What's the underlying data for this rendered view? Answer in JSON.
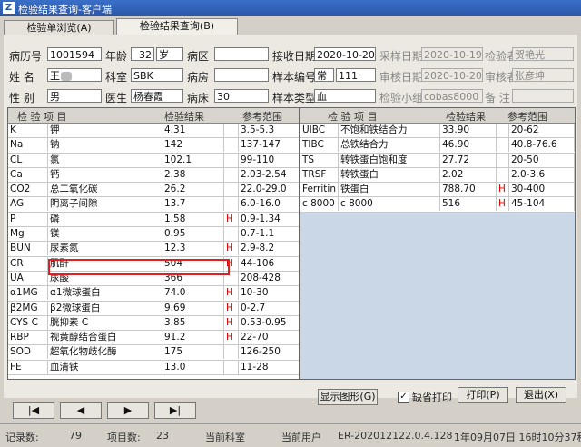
{
  "window": {
    "title": "检验结果查询-客户端"
  },
  "tabs": [
    {
      "label": "检验单浏览(A)"
    },
    {
      "label": "检验结果查询(B)"
    }
  ],
  "form": {
    "patient_id_label": "病历号",
    "patient_id": "1001594",
    "age_label": "年龄",
    "age": "32",
    "age_unit": "岁",
    "ward_label": "病区",
    "ward": "",
    "receive_date_label": "接收日期",
    "receive_date": "2020-10-20",
    "collect_date_label": "采样日期",
    "collect_date": "2020-10-19",
    "tester_label": "检验者",
    "tester": "贺艳光",
    "name_label": "姓  名",
    "name": "王",
    "dept_label": "科室",
    "dept": "SBK",
    "room_label": "病房",
    "room": "",
    "sample_no_label": "样本编号",
    "sample_no_prefix": "常",
    "sample_no": "111",
    "review_date_label": "审核日期",
    "review_date": "2020-10-20",
    "reviewer_label": "审核者",
    "reviewer": "张彦坤",
    "gender_label": "性  别",
    "gender": "男",
    "doctor_label": "医生",
    "doctor": "杨春霞",
    "bed_label": "病床",
    "bed": "30",
    "sample_type_label": "样本类型",
    "sample_type": "血",
    "group_label": "检验小组",
    "group": "cobas8000",
    "remark_label": "备  注",
    "remark": ""
  },
  "left_table": {
    "headers": [
      "检  验  项  目",
      "检验结果",
      "参考范围"
    ],
    "rows": [
      {
        "code": "K",
        "name": "钾",
        "result": "4.31",
        "flag": "",
        "range": "3.5-5.3"
      },
      {
        "code": "Na",
        "name": "钠",
        "result": "142",
        "flag": "",
        "range": "137-147"
      },
      {
        "code": "CL",
        "name": "氯",
        "result": "102.1",
        "flag": "",
        "range": "99-110"
      },
      {
        "code": "Ca",
        "name": "钙",
        "result": "2.38",
        "flag": "",
        "range": "2.03-2.54"
      },
      {
        "code": "CO2",
        "name": "总二氧化碳",
        "result": "26.2",
        "flag": "",
        "range": "22.0-29.0"
      },
      {
        "code": "AG",
        "name": "阴离子间隙",
        "result": "13.7",
        "flag": "",
        "range": "6.0-16.0"
      },
      {
        "code": "P",
        "name": "磷",
        "result": "1.58",
        "flag": "H",
        "range": "0.9-1.34"
      },
      {
        "code": "Mg",
        "name": "镁",
        "result": "0.95",
        "flag": "",
        "range": "0.7-1.1"
      },
      {
        "code": "BUN",
        "name": "尿素氮",
        "result": "12.3",
        "flag": "H",
        "range": "2.9-8.2"
      },
      {
        "code": "CR",
        "name": "肌酐",
        "result": "504",
        "flag": "H",
        "range": "44-106"
      },
      {
        "code": "UA",
        "name": "尿酸",
        "result": "366",
        "flag": "",
        "range": "208-428"
      },
      {
        "code": "α1MG",
        "name": "α1微球蛋白",
        "result": "74.0",
        "flag": "H",
        "range": "10-30"
      },
      {
        "code": "β2MG",
        "name": "β2微球蛋白",
        "result": "9.69",
        "flag": "H",
        "range": "0-2.7"
      },
      {
        "code": "CYS C",
        "name": "胱抑素 C",
        "result": "3.85",
        "flag": "H",
        "range": "0.53-0.95"
      },
      {
        "code": "RBP",
        "name": "视黄醇结合蛋白",
        "result": "91.2",
        "flag": "H",
        "range": "22-70"
      },
      {
        "code": "SOD",
        "name": "超氧化物歧化酶",
        "result": "175",
        "flag": "",
        "range": "126-250"
      },
      {
        "code": "FE",
        "name": "血清铁",
        "result": "13.0",
        "flag": "",
        "range": "11-28"
      }
    ]
  },
  "right_table": {
    "headers": [
      "检  验  项  目",
      "检验结果",
      "参考范围"
    ],
    "rows": [
      {
        "code": "UIBC",
        "name": "不饱和铁结合力",
        "result": "33.90",
        "flag": "",
        "range": "20-62"
      },
      {
        "code": "TIBC",
        "name": "总铁结合力",
        "result": "46.90",
        "flag": "",
        "range": "40.8-76.6"
      },
      {
        "code": "TS",
        "name": "转铁蛋白饱和度",
        "result": "27.72",
        "flag": "",
        "range": "20-50"
      },
      {
        "code": "TRSF",
        "name": "转铁蛋白",
        "result": "2.02",
        "flag": "",
        "range": "2.0-3.6"
      },
      {
        "code": "Ferritin",
        "name": "铁蛋白",
        "result": "788.70",
        "flag": "H",
        "range": "30-400"
      },
      {
        "code": "c 8000",
        "name": "c 8000",
        "result": "516",
        "flag": "H",
        "range": "45-104"
      }
    ]
  },
  "buttons": {
    "first": "|◀",
    "prev": "◀",
    "next": "▶",
    "last": "▶|",
    "show_graph": "显示图形(G)",
    "default_print": "缺省打印",
    "print": "打印(P)",
    "exit": "退出(X)"
  },
  "status": {
    "record_count_label": "记录数:",
    "record_count": "79",
    "item_count_label": "项目数:",
    "item_count": "23",
    "current_dept_label": "当前科室",
    "current_user_label": "当前用户",
    "version_code": "ER-20201212",
    "version": "2.0.4.128",
    "datetime": "1年09月07日 16时10分37秒 星"
  },
  "colors": {
    "flag_high": "#dd0000",
    "highlight_box": "#e02020"
  }
}
